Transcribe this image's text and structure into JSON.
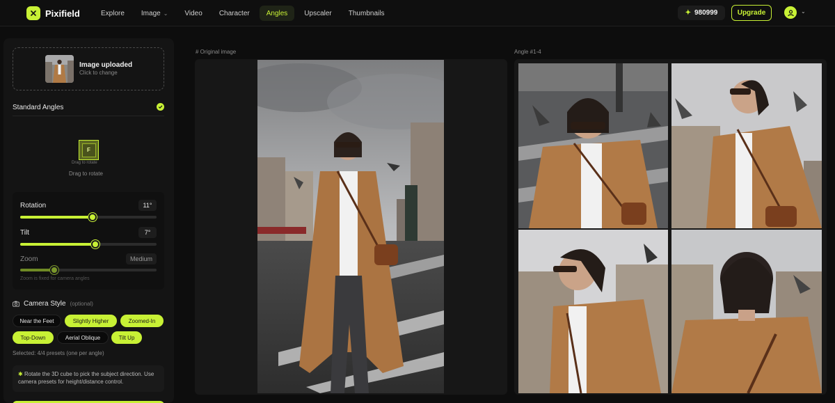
{
  "app": {
    "name": "Pixifield",
    "brand_color": "#c8f135"
  },
  "nav": {
    "items": [
      {
        "label": "Explore",
        "active": false,
        "dropdown": false
      },
      {
        "label": "Image",
        "active": false,
        "dropdown": true
      },
      {
        "label": "Video",
        "active": false,
        "dropdown": false
      },
      {
        "label": "Character",
        "active": false,
        "dropdown": false
      },
      {
        "label": "Angles",
        "active": true,
        "dropdown": false
      },
      {
        "label": "Upscaler",
        "active": false,
        "dropdown": false
      },
      {
        "label": "Thumbnails",
        "active": false,
        "dropdown": false
      }
    ],
    "credits": "980999",
    "upgrade_label": "Upgrade"
  },
  "upload": {
    "title": "Image uploaded",
    "subtitle": "Click to change"
  },
  "standard_angles": {
    "label": "Standard Angles",
    "checked": true
  },
  "cube": {
    "face_letter": "F",
    "caption": "Drag to rotate",
    "hint": "Drag to rotate"
  },
  "controls": {
    "rotation": {
      "label": "Rotation",
      "value": "11°",
      "fraction": 0.53
    },
    "tilt": {
      "label": "Tilt",
      "value": "7°",
      "fraction": 0.55
    },
    "zoom": {
      "label": "Zoom",
      "value": "Medium",
      "fraction": 0.25,
      "disabled": true
    },
    "zoom_note": "Zoom is fixed for camera angles"
  },
  "camera_style": {
    "title": "Camera Style",
    "optional": "(optional)",
    "presets": [
      {
        "label": "Near the Feet",
        "selected": false
      },
      {
        "label": "Slightly Higher",
        "selected": true
      },
      {
        "label": "Zoomed-In",
        "selected": true
      },
      {
        "label": "Top-Down",
        "selected": true
      },
      {
        "label": "Aerial Oblique",
        "selected": false
      },
      {
        "label": "Tilt Up",
        "selected": true
      }
    ],
    "selected_note": "Selected: 4/4 presets (one per angle)"
  },
  "tip": {
    "text": "Rotate the 3D cube to pick the subject direction. Use camera presets for height/distance control."
  },
  "panels": {
    "original_label": "# Original image",
    "angles_label": "Angle #1-4"
  }
}
